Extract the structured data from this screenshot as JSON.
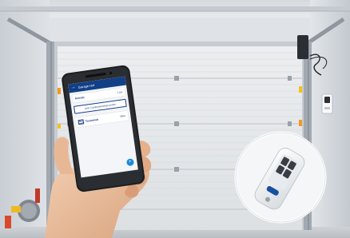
{
  "phone_app": {
    "title": "Garage Hof",
    "device_name": "Antrieb",
    "device_status": "",
    "device_value": "1 bei",
    "action_label": "Jetzt Zustandsanzeige prüfen",
    "section_label": "",
    "door_name": "Torantrieb",
    "door_sub": "",
    "door_state": "Offen",
    "fab_symbol": "+"
  },
  "colors": {
    "app_bar": "#123f86",
    "accent": "#1c8ad8",
    "door_panel": "#e4e7ea",
    "remote_button_blue": "#1a4fa0"
  },
  "icons": [
    "door-icon",
    "back-arrow-icon",
    "plus-icon",
    "remote-control-icon",
    "wall-button-icon"
  ]
}
